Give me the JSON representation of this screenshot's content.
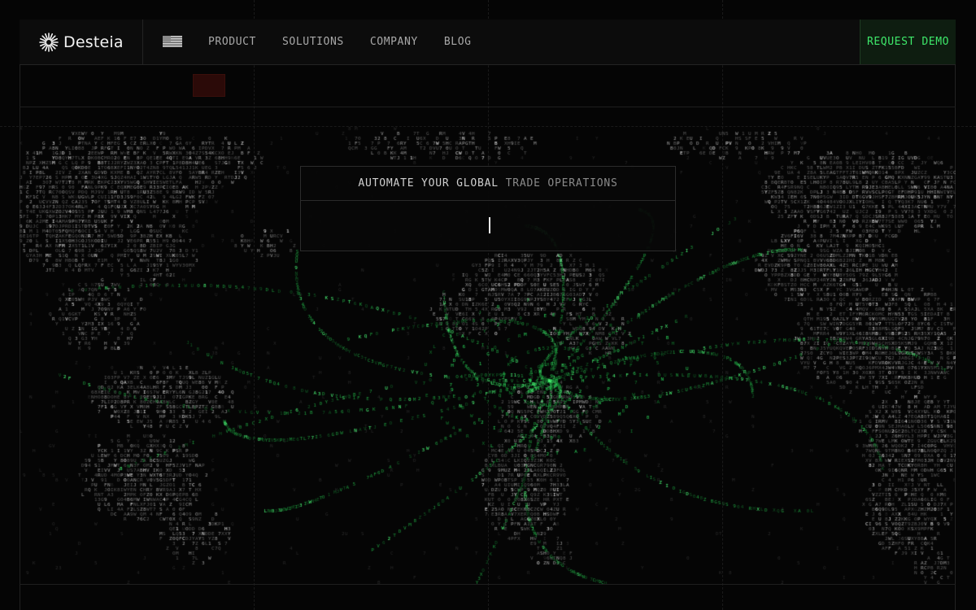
{
  "brand": {
    "name": "Desteia",
    "logo_icon": "starburst-icon"
  },
  "nav": {
    "flag_icon": "us-flag-icon",
    "links": [
      {
        "label": "PRODUCT"
      },
      {
        "label": "SOLUTIONS"
      },
      {
        "label": "COMPANY"
      },
      {
        "label": "BLOG"
      }
    ],
    "cta_label": "REQUEST DEMO"
  },
  "hero": {
    "title_bright": "AUTOMATE YOUR GLOBAL ",
    "title_dim": "TRADE OPERATIONS",
    "search_value": ""
  },
  "colors": {
    "accent_green": "#3ee86a",
    "cta_bg": "#0e1d10",
    "rec_red": "#2b0a08",
    "background": "#050505"
  }
}
